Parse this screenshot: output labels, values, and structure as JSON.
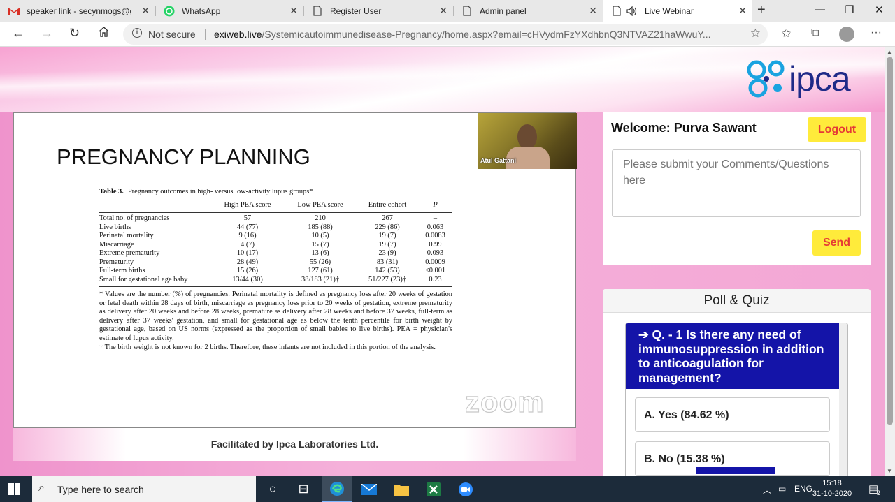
{
  "browser": {
    "tabs": [
      {
        "label": "speaker link - secynmogs@gm",
        "icon": "gmail-icon",
        "active": false
      },
      {
        "label": "WhatsApp",
        "icon": "whatsapp-icon",
        "active": false
      },
      {
        "label": "Register User",
        "icon": "page-icon",
        "active": false
      },
      {
        "label": "Admin panel",
        "icon": "page-icon",
        "active": false
      },
      {
        "label": "Live Webinar",
        "icon": "page-icon",
        "active": true
      }
    ],
    "not_secure": "Not secure",
    "url_host": "exiweb.live",
    "url_path": "/Systemicautoimmunedisease-Pregnancy/home.aspx?email=cHVydmFzYXdhbnQ3NTVAZ21haWwuY..."
  },
  "brand": {
    "logo_text": "ipca",
    "accent": "#1f2a88"
  },
  "slide": {
    "title": "PREGNANCY PLANNING",
    "speaker_name": "Atul Gattani",
    "table": {
      "label": "Table 3.",
      "caption": "Pregnancy outcomes in high- versus low-activity lupus groups*",
      "headers": [
        "",
        "High PEA score",
        "Low PEA score",
        "Entire cohort",
        "P"
      ],
      "rows": [
        [
          "Total no. of pregnancies",
          "57",
          "210",
          "267",
          "–"
        ],
        [
          "Live births",
          "44 (77)",
          "185 (88)",
          "229 (86)",
          "0.063"
        ],
        [
          "Perinatal mortality",
          "9 (16)",
          "10 (5)",
          "19 (7)",
          "0.0083"
        ],
        [
          "Miscarriage",
          "4 (7)",
          "15 (7)",
          "19 (7)",
          "0.99"
        ],
        [
          "Extreme prematurity",
          "10 (17)",
          "13 (6)",
          "23 (9)",
          "0.093"
        ],
        [
          "Prematurity",
          "28 (49)",
          "55 (26)",
          "83 (31)",
          "0.0009"
        ],
        [
          "Full-term births",
          "15 (26)",
          "127 (61)",
          "142 (53)",
          "<0.001"
        ],
        [
          "Small for gestational age baby",
          "13/44 (30)",
          "38/183 (21)†",
          "51/227 (23)†",
          "0.23"
        ]
      ],
      "footnote_1": "* Values are the number (%) of pregnancies. Perinatal mortality is defined as pregnancy loss after 20 weeks of gestation or fetal death within 28 days of birth, miscarriage as pregnancy loss prior to 20 weeks of gestation, extreme prematurity as delivery after 20 weeks and before 28 weeks, premature as delivery after 28 weeks and before 37 weeks, full-term as delivery after 37 weeks' gestation, and small for gestational age as below the tenth percentile for birth weight by gestational age, based on US norms (expressed as the proportion of small babies to live births). PEA = physician's estimate of lupus activity.",
      "footnote_2": "† The birth weight is not known for 2 births. Therefore, these infants are not included in this portion of the analysis."
    },
    "watermark": "zoom",
    "facilitated_by": "Facilitated by Ipca Laboratories Ltd."
  },
  "comments": {
    "welcome": "Welcome: Purva Sawant",
    "logout_label": "Logout",
    "placeholder": "Please submit your Comments/Questions here",
    "send_label": "Send"
  },
  "poll": {
    "header": "Poll & Quiz",
    "question": "➔ Q. - 1 Is there any need of immunosuppression in addition to anticoagulation for management?",
    "options": [
      {
        "label": "A. Yes (84.62 %)",
        "percent": 84.62
      },
      {
        "label": "B. No (15.38 %)",
        "percent": 15.38
      }
    ]
  },
  "taskbar": {
    "search_placeholder": "Type here to search",
    "language": "ENG",
    "time": "15:18",
    "date": "31-10-2020",
    "notification_count": "2"
  },
  "colors": {
    "button_yellow": "#ffeb3b",
    "button_text_red": "#e53935",
    "question_bg": "#1414a8",
    "page_pink": "#ef93cc"
  }
}
